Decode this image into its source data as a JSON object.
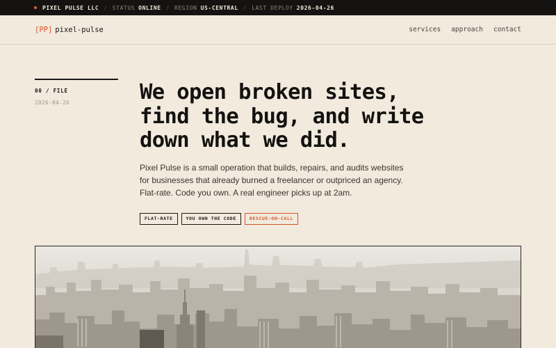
{
  "status_bar": {
    "company": "PIXEL PULSE LLC",
    "status_label": "STATUS",
    "status_value": "ONLINE",
    "region_label": "REGION",
    "region_value": "US-CENTRAL",
    "deploy_label": "LAST DEPLOY",
    "deploy_value": "2026-04-26",
    "accent_color": "#e0603a"
  },
  "header": {
    "logo_tag": "[PP]",
    "logo_text": "pixel-pulse",
    "nav": [
      "services",
      "approach",
      "contact"
    ]
  },
  "meta": {
    "label": "00 / FILE",
    "date": "2026-04-26"
  },
  "hero": {
    "headline_lines": [
      "We open broken sites,",
      "find the bug, and write",
      "down what we did."
    ],
    "lede_lines": [
      "Pixel Pulse is a small operation that builds, repairs, and audits websites",
      "for businesses that already burned a freelancer or outpriced an agency.",
      "Flat-rate. Code you own. A real engineer picks up at 2am."
    ],
    "tags": [
      "FLAT-RATE",
      "YOU OWN THE CODE",
      "RESCUE-ON-CALL"
    ],
    "image_subject": "city-skyline-photo"
  },
  "colors": {
    "background": "#f1eadd",
    "ink": "#141210",
    "accent": "#d9532a"
  }
}
